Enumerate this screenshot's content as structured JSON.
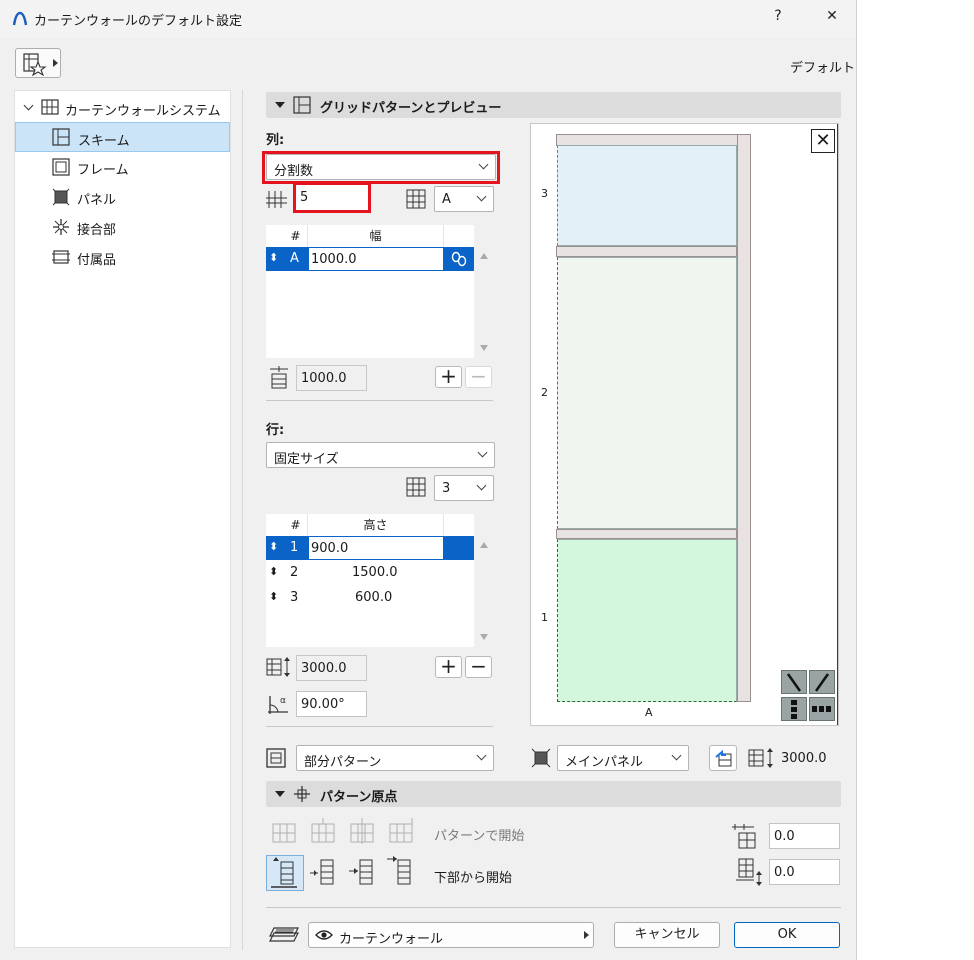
{
  "window": {
    "title": "カーテンウォールのデフォルト設定",
    "help": "?",
    "close": "✕"
  },
  "header": {
    "default_label": "デフォルト"
  },
  "tree": {
    "root": "カーテンウォールシステム",
    "items": [
      {
        "label": "スキーム",
        "selected": true
      },
      {
        "label": "フレーム"
      },
      {
        "label": "パネル"
      },
      {
        "label": "接合部"
      },
      {
        "label": "付属品"
      }
    ]
  },
  "grid_section": {
    "title": "グリッドパターンとプレビュー",
    "columns": {
      "label": "列:",
      "mode": "分割数",
      "count": "5",
      "set_value": "A",
      "table": {
        "headers": [
          "#",
          "幅"
        ],
        "rows": [
          {
            "id": "A",
            "value": "1000.0"
          }
        ]
      },
      "total": "1000.0"
    },
    "rows": {
      "label": "行:",
      "mode": "固定サイズ",
      "count": "3",
      "table": {
        "headers": [
          "#",
          "高さ"
        ],
        "rows": [
          {
            "id": "1",
            "value": "900.0"
          },
          {
            "id": "2",
            "value": "1500.0"
          },
          {
            "id": "3",
            "value": "600.0"
          }
        ]
      },
      "total": "3000.0",
      "angle": "90.00°"
    },
    "pattern_select": "部分パターン",
    "panel_select": "メインパネル",
    "panel_height": "3000.0",
    "preview": {
      "row_labels": [
        "3",
        "2",
        "1"
      ],
      "col_label": "A",
      "close": "✕"
    }
  },
  "origin_section": {
    "title": "パターン原点",
    "start_pattern": "パターンで開始",
    "start_bottom": "下部から開始",
    "offset_x": "0.0",
    "offset_y": "0.0"
  },
  "footer": {
    "layer": "カーテンウォール",
    "cancel": "キャンセル",
    "ok": "OK"
  }
}
